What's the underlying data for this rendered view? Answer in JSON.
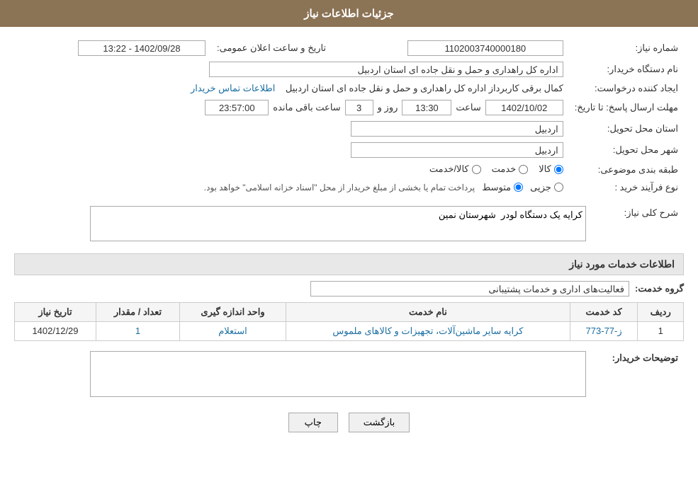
{
  "page": {
    "title": "جزئیات اطلاعات نیاز",
    "header": {
      "label": "جزئیات اطلاعات نیاز"
    },
    "fields": {
      "need_number_label": "شماره نیاز:",
      "need_number_value": "1102003740000180",
      "announce_date_label": "تاریخ و ساعت اعلان عمومی:",
      "announce_date_value": "1402/09/28 - 13:22",
      "org_name_label": "نام دستگاه خریدار:",
      "org_name_value": "اداره کل راهداری و حمل و نقل جاده ای استان اردبیل",
      "creator_label": "ایجاد کننده درخواست:",
      "creator_value": "کمال برقی کاربرداز اداره کل راهداری و حمل و نقل جاده ای استان اردبیل",
      "contact_link": "اطلاعات تماس خریدار",
      "deadline_label": "مهلت ارسال پاسخ: تا تاریخ:",
      "deadline_date": "1402/10/02",
      "deadline_time_label": "ساعت",
      "deadline_time": "13:30",
      "deadline_day_label": "روز و",
      "deadline_days": "3",
      "remaining_time_label": "ساعت باقی مانده",
      "remaining_time": "23:57:00",
      "province_label": "استان محل تحویل:",
      "province_value": "اردبیل",
      "city_label": "شهر محل تحویل:",
      "city_value": "اردبیل",
      "category_label": "طبقه بندی موضوعی:",
      "category_options": [
        "کالا",
        "خدمت",
        "کالا/خدمت"
      ],
      "category_selected": "کالا",
      "purchase_type_label": "نوع فرآیند خرید :",
      "purchase_type_options": [
        "جزیی",
        "متوسط"
      ],
      "purchase_type_selected": "متوسط",
      "purchase_type_notice": "پرداخت تمام یا بخشی از مبلغ خریدار از محل \"اسناد خزانه اسلامی\" خواهد بود.",
      "need_summary_label": "شرح کلی نیاز:",
      "need_summary_value": "کرایه یک دستگاه لودر  شهرستان نمین",
      "services_section_label": "اطلاعات خدمات مورد نیاز",
      "service_group_label": "گروه خدمت:",
      "service_group_value": "فعالیت‌های اداری و خدمات پشتیبانی",
      "table_headers": [
        "ردیف",
        "کد خدمت",
        "نام خدمت",
        "واحد اندازه گیری",
        "تعداد / مقدار",
        "تاریخ نیاز"
      ],
      "table_rows": [
        {
          "row": "1",
          "code": "ز-77-773",
          "name": "کرایه سایر ماشین‌آلات، تجهیزات و کالاهای ملموس",
          "unit": "استعلام",
          "quantity": "1",
          "date": "1402/12/29"
        }
      ],
      "buyer_description_label": "توضیحات خریدار:",
      "buyer_description_value": "",
      "buttons": {
        "print": "چاپ",
        "back": "بازگشت"
      }
    }
  }
}
